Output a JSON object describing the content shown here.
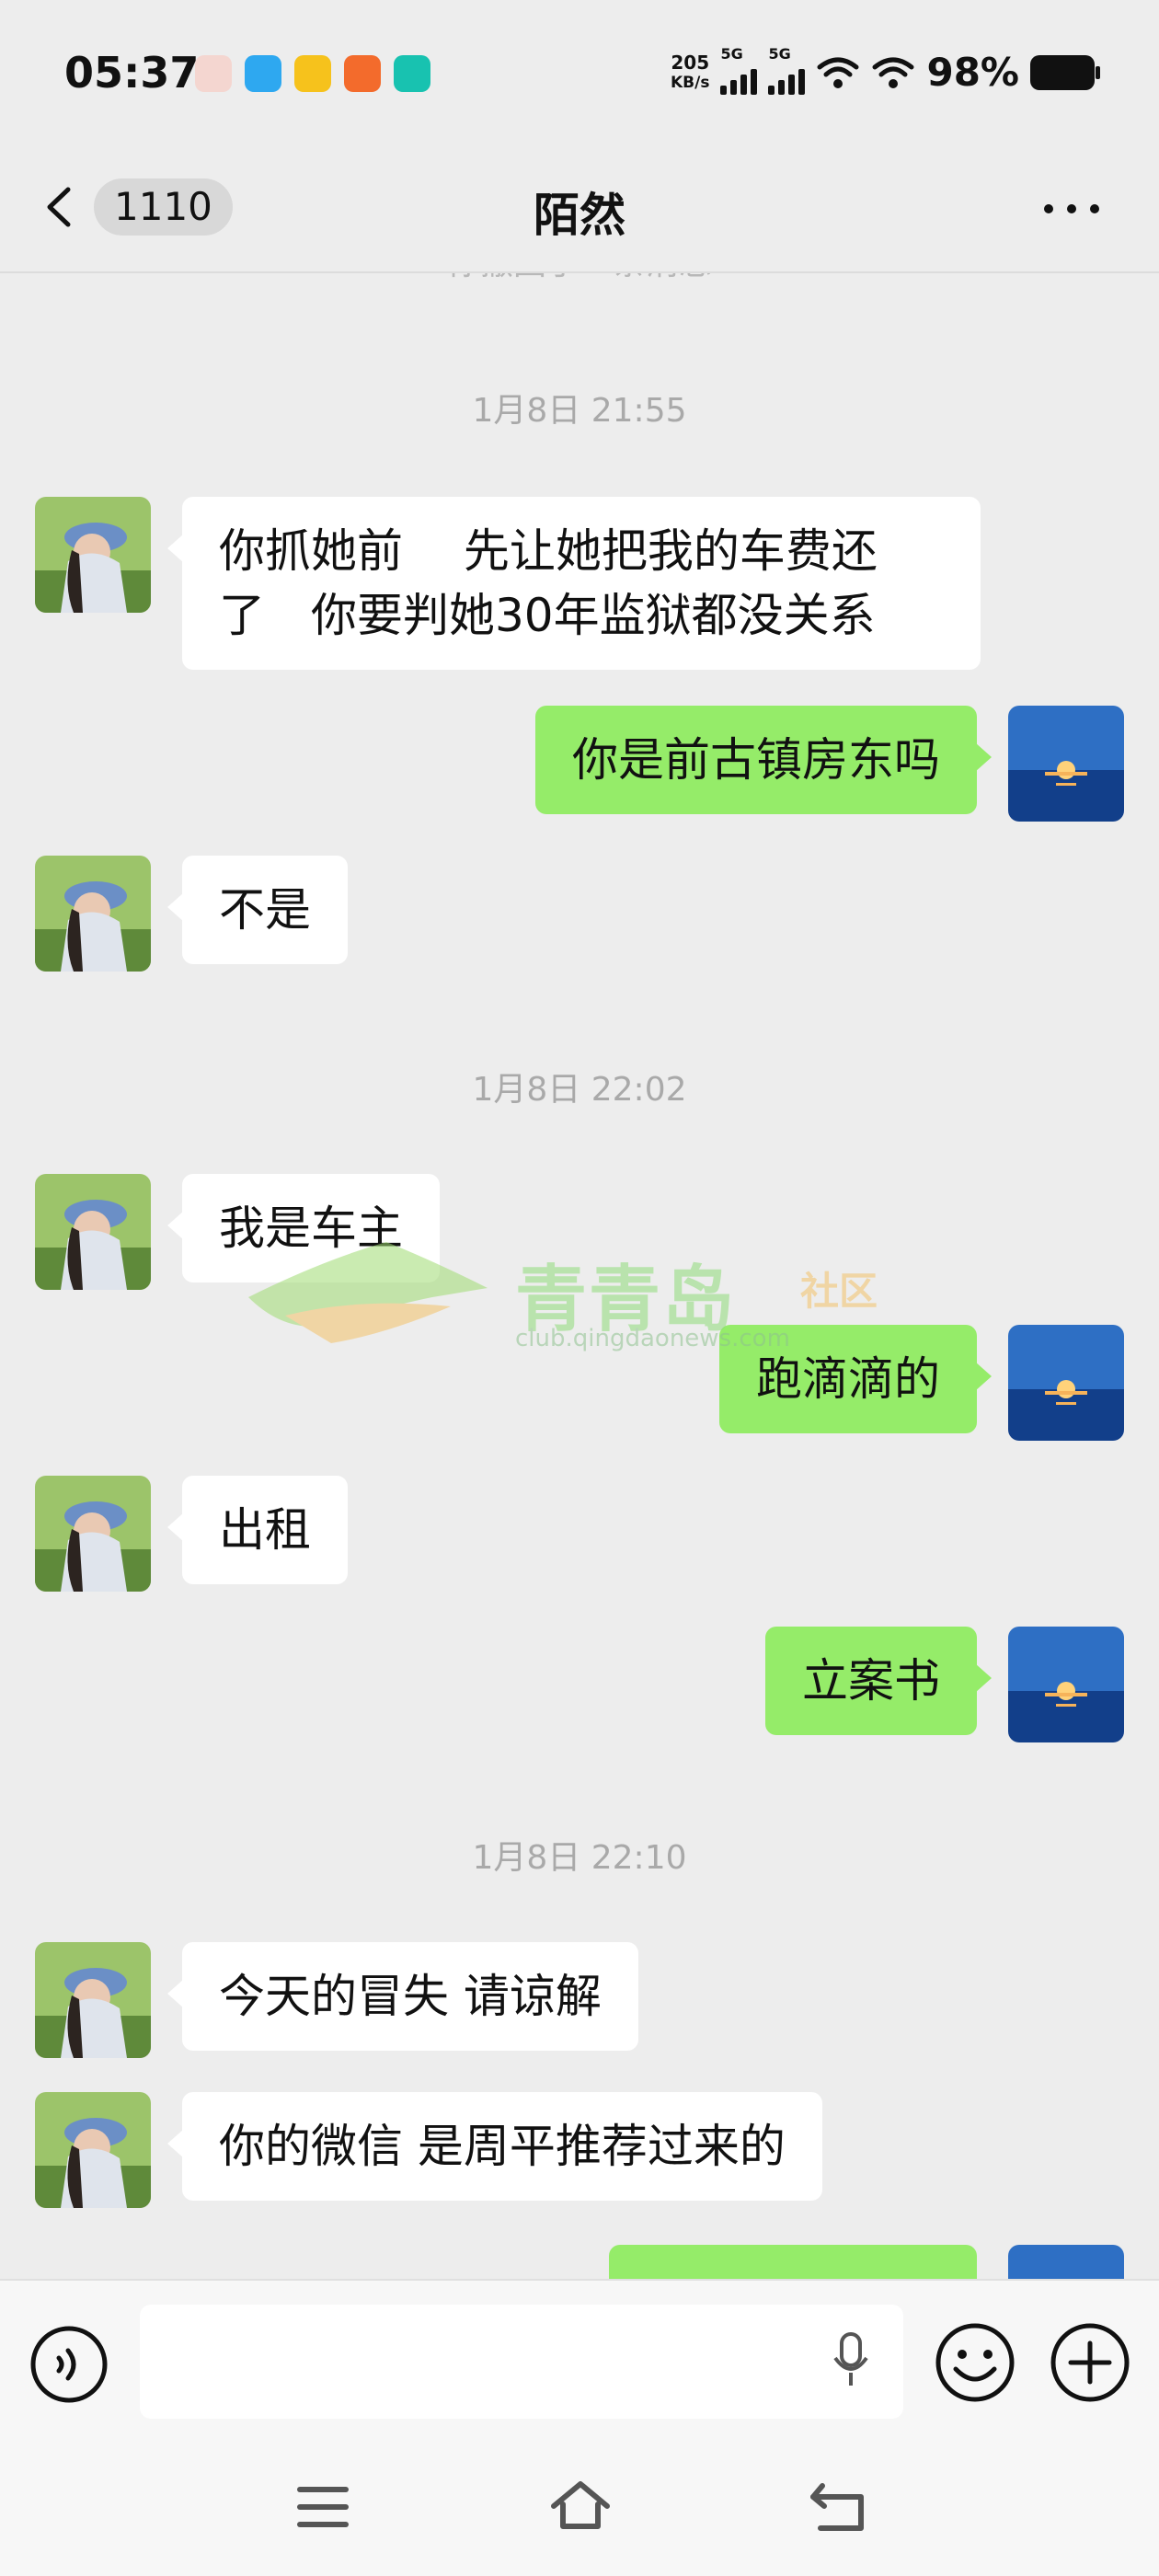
{
  "status_bar": {
    "time": "05:37",
    "net_speed_value": "205",
    "net_speed_unit": "KB/s",
    "signal_1_label": "5G",
    "signal_2_label": "5G",
    "battery_percent": "98%",
    "app_icons": [
      "avatar-app-icon",
      "chat-bubble-app-icon",
      "game-app-icon",
      "orange-grid-app-icon",
      "teal-app-icon"
    ]
  },
  "header": {
    "unread_count": "1110",
    "title": "陌然",
    "more_icon": "more-dots-icon"
  },
  "conversation": {
    "cutoff_text": "你撤回了一条消息",
    "timestamps": [
      "1月8日 21:55",
      "1月8日 22:02",
      "1月8日 22:10"
    ],
    "messages": [
      {
        "side": "in",
        "lines": [
          "你抓她前　 先让她把我的车费还",
          "了　你要判她30年监狱都没关系"
        ]
      },
      {
        "side": "out",
        "text": "你是前古镇房东吗"
      },
      {
        "side": "in",
        "text": "不是"
      },
      {
        "side": "in",
        "text": "我是车主"
      },
      {
        "side": "out",
        "text": "跑滴滴的"
      },
      {
        "side": "in",
        "text": "出租"
      },
      {
        "side": "out",
        "text": "立案书"
      },
      {
        "side": "in",
        "text": "今天的冒失  请谅解"
      },
      {
        "side": "in",
        "text": "你的微信  是周平推荐过来的"
      }
    ]
  },
  "watermark": {
    "name": "青青岛",
    "tag": "社区",
    "url": "club.qingdaonews.com"
  },
  "input_bar": {
    "value": "",
    "icons": [
      "voice-icon",
      "mic-icon",
      "emoji-icon",
      "plus-icon"
    ]
  },
  "system_nav": {
    "icons": [
      "menu-icon",
      "home-icon",
      "back-icon"
    ]
  },
  "colors": {
    "background": "#ededed",
    "incoming_bubble": "#ffffff",
    "outgoing_bubble": "#95ec69",
    "timestamp": "#a9a9a9"
  }
}
